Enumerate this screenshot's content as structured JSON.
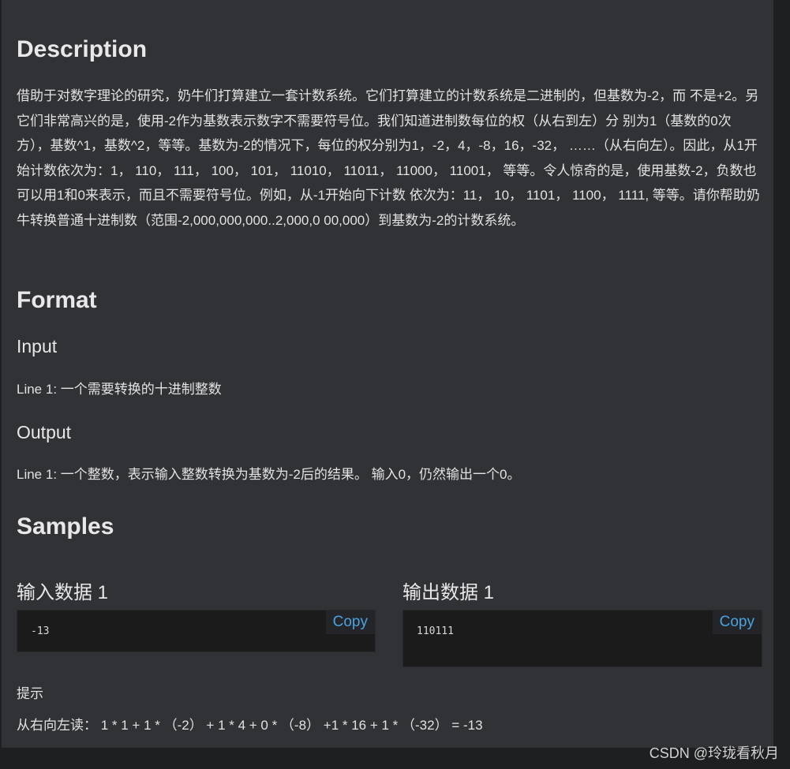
{
  "description": {
    "heading": "Description",
    "text": "借助于对数字理论的研究，奶牛们打算建立一套计数系统。它们打算建立的计数系统是二进制的，但基数为-2，而 不是+2。另它们非常高兴的是，使用-2作为基数表示数字不需要符号位。我们知道进制数每位的权（从右到左）分 别为1（基数的0次方），基数^1，基数^2，等等。基数为-2的情况下，每位的权分别为1，-2，4，-8，16，-32， ……（从右向左）。因此，从1开始计数依次为：1， 110， 111， 100， 101， 11010， 11011， 11000， 11001， 等等。令人惊奇的是，使用基数-2，负数也可以用1和0来表示，而且不需要符号位。例如，从-1开始向下计数 依次为：11， 10， 1101， 1100， 1111, 等等。请你帮助奶牛转换普通十进制数（范围-2,000,000,000..2,000,0 00,000）到基数为-2的计数系统。"
  },
  "format": {
    "heading": "Format",
    "input_heading": "Input",
    "input_text": "Line 1: 一个需要转换的十进制整数",
    "output_heading": "Output",
    "output_text": "Line 1: 一个整数，表示输入整数转换为基数为-2后的结果。 输入0，仍然输出一个0。"
  },
  "samples": {
    "heading": "Samples",
    "input_title": "输入数据 1",
    "input_value": "-13",
    "output_title": "输出数据 1",
    "output_value": "110111",
    "copy_label": "Copy"
  },
  "hint": {
    "label": "提示",
    "text": "从右向左读： 1 * 1 + 1 * （-2） + 1 * 4 + 0 * （-8） +1 * 16 + 1 * （-32） = -13"
  },
  "watermark": "CSDN @玲珑看秋月",
  "colors": {
    "background": "#313235",
    "code_background": "#1b1b1c",
    "link": "#4aa3df"
  }
}
